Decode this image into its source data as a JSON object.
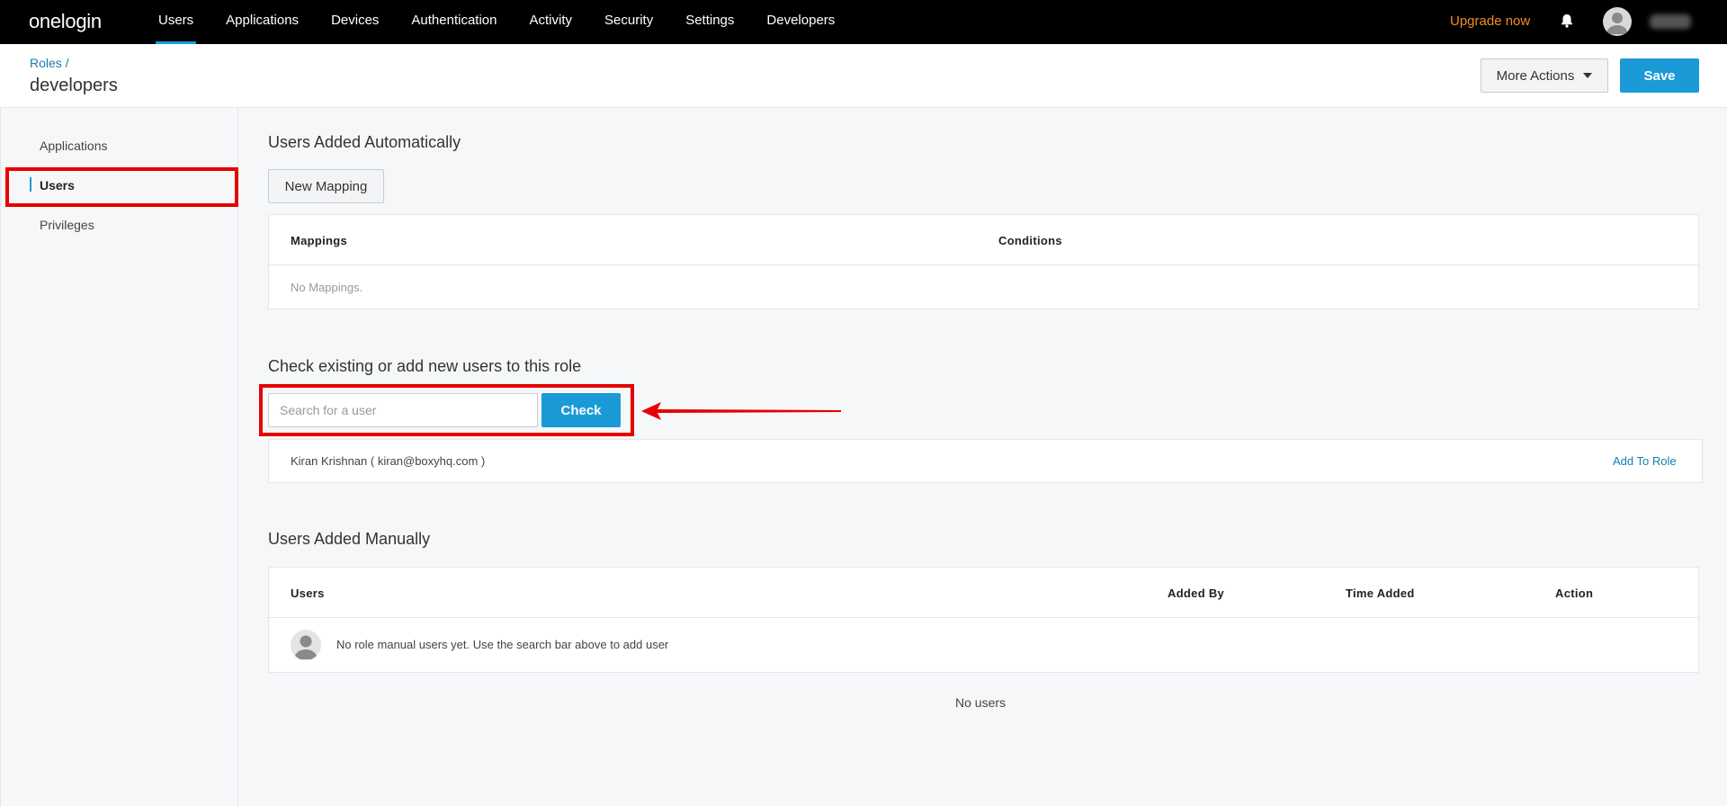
{
  "nav": {
    "logo": "onelogin",
    "items": [
      {
        "label": "Users",
        "active": true
      },
      {
        "label": "Applications",
        "active": false
      },
      {
        "label": "Devices",
        "active": false
      },
      {
        "label": "Authentication",
        "active": false
      },
      {
        "label": "Activity",
        "active": false
      },
      {
        "label": "Security",
        "active": false
      },
      {
        "label": "Settings",
        "active": false
      },
      {
        "label": "Developers",
        "active": false
      }
    ],
    "upgrade_label": "Upgrade now",
    "accent_color": "#1a9bd7",
    "upgrade_color": "#f28c1f"
  },
  "header": {
    "breadcrumb": "Roles /",
    "title": "developers",
    "more_actions_label": "More Actions",
    "save_label": "Save"
  },
  "sidebar": {
    "items": [
      {
        "label": "Applications"
      },
      {
        "label": "Users"
      },
      {
        "label": "Privileges"
      }
    ]
  },
  "auto_section": {
    "title": "Users Added Automatically",
    "new_mapping_label": "New Mapping",
    "columns": [
      "Mappings",
      "Conditions"
    ],
    "empty_text": "No Mappings."
  },
  "check_section": {
    "title": "Check existing or add new users to this role",
    "search_placeholder": "Search for a user",
    "check_label": "Check",
    "result_name": "Kiran Krishnan ( kiran@boxyhq.com )",
    "add_to_role_label": "Add To Role"
  },
  "manual_section": {
    "title": "Users Added Manually",
    "columns": [
      "Users",
      "Added By",
      "Time Added",
      "Action"
    ],
    "empty_row_text": "No role manual users yet. Use the search bar above to add user",
    "no_users_text": "No users"
  },
  "annotations": {
    "highlight_color": "#e60000"
  }
}
